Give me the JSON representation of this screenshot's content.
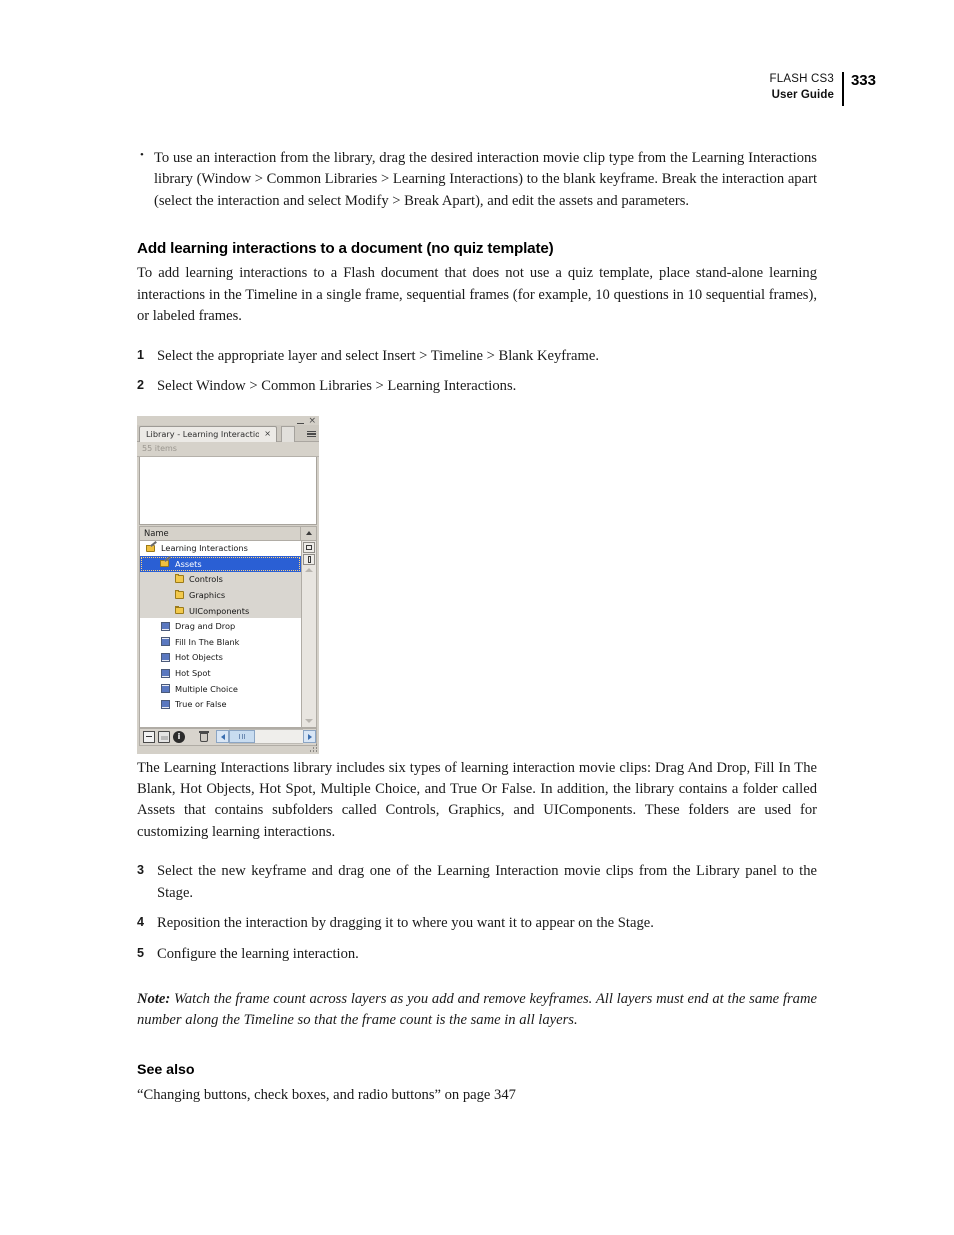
{
  "header": {
    "product": "FLASH CS3",
    "guide": "User Guide",
    "page_number": "333"
  },
  "bullets": [
    "To use an interaction from the library, drag the desired interaction movie clip type from the Learning Interactions library (Window > Common Libraries > Learning Interactions) to the blank keyframe. Break the interaction apart (select the interaction and select Modify > Break Apart), and edit the assets and parameters."
  ],
  "section": {
    "heading": "Add learning interactions to a document (no quiz template)",
    "intro": "To add learning interactions to a Flash document that does not use a quiz template, place stand-alone learning interactions in the Timeline in a single frame, sequential frames (for example, 10 questions in 10 sequential frames), or labeled frames."
  },
  "steps_first": [
    {
      "num": "1",
      "text": "Select the appropriate layer and select Insert > Timeline > Blank Keyframe."
    },
    {
      "num": "2",
      "text": "Select Window > Common Libraries > Learning Interactions."
    }
  ],
  "figure": {
    "window_controls": {
      "minimize": "–",
      "close": "×"
    },
    "tab": {
      "label": "Library - Learning Interactions...",
      "close": "×"
    },
    "panel_menu_icon": "panel-options-icon",
    "items_count": "55 items",
    "column_header": {
      "name": "Name",
      "sort_icon": "sort-ascending-icon"
    },
    "tree_rows": [
      {
        "label": "Learning Interactions",
        "icon": "folder-pencil-icon",
        "indent": "indent-1",
        "state": "normal"
      },
      {
        "label": "Assets",
        "icon": "folder-pencil-icon",
        "indent": "indent-2",
        "state": "selected"
      },
      {
        "label": "Controls",
        "icon": "folder-icon",
        "indent": "indent-3",
        "state": "shaded"
      },
      {
        "label": "Graphics",
        "icon": "folder-icon",
        "indent": "indent-3",
        "state": "shaded"
      },
      {
        "label": "UIComponents",
        "icon": "folder-icon",
        "indent": "indent-3",
        "state": "shaded"
      },
      {
        "label": "Drag and Drop",
        "icon": "movieclip-icon",
        "indent": "indent-mc",
        "state": "normal"
      },
      {
        "label": "Fill In The Blank",
        "icon": "movieclip-icon",
        "indent": "indent-mc",
        "state": "normal"
      },
      {
        "label": "Hot Objects",
        "icon": "movieclip-icon",
        "indent": "indent-mc",
        "state": "normal"
      },
      {
        "label": "Hot Spot",
        "icon": "movieclip-icon",
        "indent": "indent-mc",
        "state": "normal"
      },
      {
        "label": "Multiple Choice",
        "icon": "movieclip-icon",
        "indent": "indent-mc",
        "state": "normal"
      },
      {
        "label": "True or False",
        "icon": "movieclip-icon",
        "indent": "indent-mc",
        "state": "normal"
      }
    ],
    "toolbar": {
      "new_symbol": "new-symbol-icon",
      "new_folder": "new-folder-icon",
      "properties": "i",
      "delete": "trash-icon",
      "scroll_left": "scroll-left-arrow",
      "scroll_right": "scroll-right-arrow"
    },
    "colors": {
      "selection_blue": "#2a5fd4",
      "panel_chrome": "#d4d0c8",
      "folder_yellow": "#f2c94c",
      "movieclip_blue": "#5a78c0"
    }
  },
  "body_paragraph": "The Learning Interactions library includes six types of learning interaction movie clips: Drag And Drop, Fill In The Blank, Hot Objects, Hot Spot, Multiple Choice, and True Or False. In addition, the library contains a folder called Assets that contains subfolders called Controls, Graphics, and UIComponents. These folders are used for customizing learning interactions.",
  "steps_second": [
    {
      "num": "3",
      "text": "Select the new keyframe and drag one of the Learning Interaction movie clips from the Library panel to the Stage."
    },
    {
      "num": "4",
      "text": "Reposition the interaction by dragging it to where you want it to appear on the Stage."
    },
    {
      "num": "5",
      "text": "Configure the learning interaction."
    }
  ],
  "note": {
    "label": "Note:",
    "text": " Watch the frame count across layers as you add and remove keyframes. All layers must end at the same frame number along the Timeline so that the frame count is the same in all layers."
  },
  "see_also": {
    "heading": "See also",
    "link": "“Changing buttons, check boxes, and radio buttons” on page 347"
  }
}
